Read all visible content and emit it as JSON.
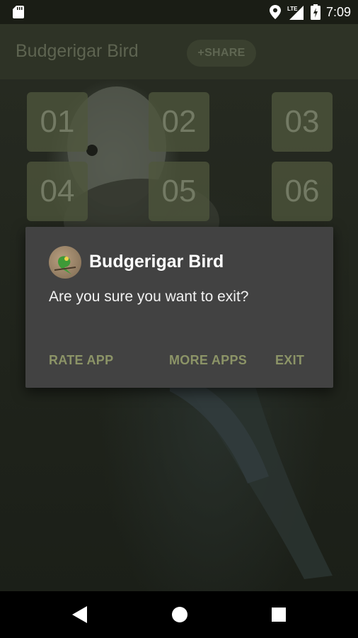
{
  "status_bar": {
    "time": "7:09",
    "network_label": "LTE",
    "icons": [
      "sd-card-icon",
      "location-icon",
      "signal-icon",
      "battery-icon"
    ]
  },
  "app_bar": {
    "title": "Budgerigar Bird",
    "share_label": "+SHARE"
  },
  "grid": {
    "tiles": [
      "01",
      "02",
      "03",
      "04",
      "05",
      "06"
    ]
  },
  "dialog": {
    "title": "Budgerigar Bird",
    "message": "Are you sure you want to exit?",
    "buttons": {
      "rate": "RATE APP",
      "more": "MORE APPS",
      "exit": "EXIT"
    },
    "accent_color": "#8c9467"
  },
  "nav_bar": {
    "icons": [
      "back-icon",
      "home-icon",
      "recents-icon"
    ]
  }
}
